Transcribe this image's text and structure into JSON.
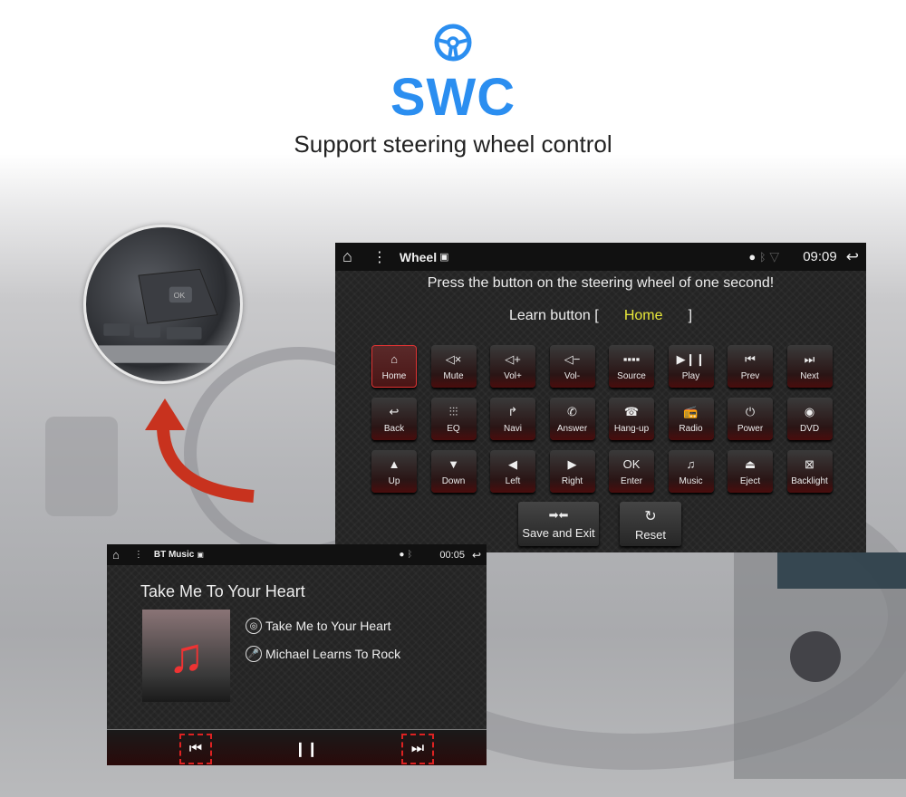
{
  "hero": {
    "icon": "steering-wheel-icon",
    "title": "SWC",
    "subtitle": "Support steering wheel control",
    "accent": "#2b8ef0"
  },
  "wheel_screen": {
    "app_title": "Wheel",
    "time": "09:09",
    "prompt": "Press the button on the steering wheel of one second!",
    "learn_label": "Learn button",
    "learn_open": "[",
    "learn_close": "]",
    "learn_value": "Home",
    "buttons": [
      {
        "label": "Home",
        "icon": "home-icon",
        "glyph": "⌂",
        "selected": true
      },
      {
        "label": "Mute",
        "icon": "mute-icon",
        "glyph": "◁×"
      },
      {
        "label": "Vol+",
        "icon": "volume-up-icon",
        "glyph": "◁+"
      },
      {
        "label": "Vol-",
        "icon": "volume-down-icon",
        "glyph": "◁−"
      },
      {
        "label": "Source",
        "icon": "source-icon",
        "glyph": "▪▪▪▪"
      },
      {
        "label": "Play",
        "icon": "play-pause-icon",
        "glyph": "▶❙❙"
      },
      {
        "label": "Prev",
        "icon": "previous-icon",
        "glyph": "⏮"
      },
      {
        "label": "Next",
        "icon": "next-icon",
        "glyph": "⏭"
      },
      {
        "label": "Back",
        "icon": "back-icon",
        "glyph": "↩"
      },
      {
        "label": "EQ",
        "icon": "equalizer-icon",
        "glyph": "⫶⫶⫶"
      },
      {
        "label": "Navi",
        "icon": "navigation-icon",
        "glyph": "↱"
      },
      {
        "label": "Answer",
        "icon": "phone-answer-icon",
        "glyph": "✆"
      },
      {
        "label": "Hang-up",
        "icon": "hang-up-icon",
        "glyph": "☎"
      },
      {
        "label": "Radio",
        "icon": "radio-icon",
        "glyph": "📻"
      },
      {
        "label": "Power",
        "icon": "power-icon",
        "glyph": "⏻"
      },
      {
        "label": "DVD",
        "icon": "disc-icon",
        "glyph": "◉"
      },
      {
        "label": "Up",
        "icon": "up-arrow-icon",
        "glyph": "▲"
      },
      {
        "label": "Down",
        "icon": "down-arrow-icon",
        "glyph": "▼"
      },
      {
        "label": "Left",
        "icon": "left-arrow-icon",
        "glyph": "◀"
      },
      {
        "label": "Right",
        "icon": "right-arrow-icon",
        "glyph": "▶"
      },
      {
        "label": "Enter",
        "icon": "ok-icon",
        "glyph": "OK"
      },
      {
        "label": "Music",
        "icon": "music-note-icon",
        "glyph": "♫"
      },
      {
        "label": "Eject",
        "icon": "eject-icon",
        "glyph": "⏏"
      },
      {
        "label": "Backlight",
        "icon": "backlight-icon",
        "glyph": "⊠"
      }
    ],
    "save_label": "Save and Exit",
    "reset_label": "Reset"
  },
  "music_screen": {
    "app_title": "BT Music",
    "time": "00:05",
    "heading": "Take Me To Your Heart",
    "track": "Take Me to Your Heart",
    "artist": "Michael Learns To Rock",
    "highlight_color": "#d22222"
  }
}
